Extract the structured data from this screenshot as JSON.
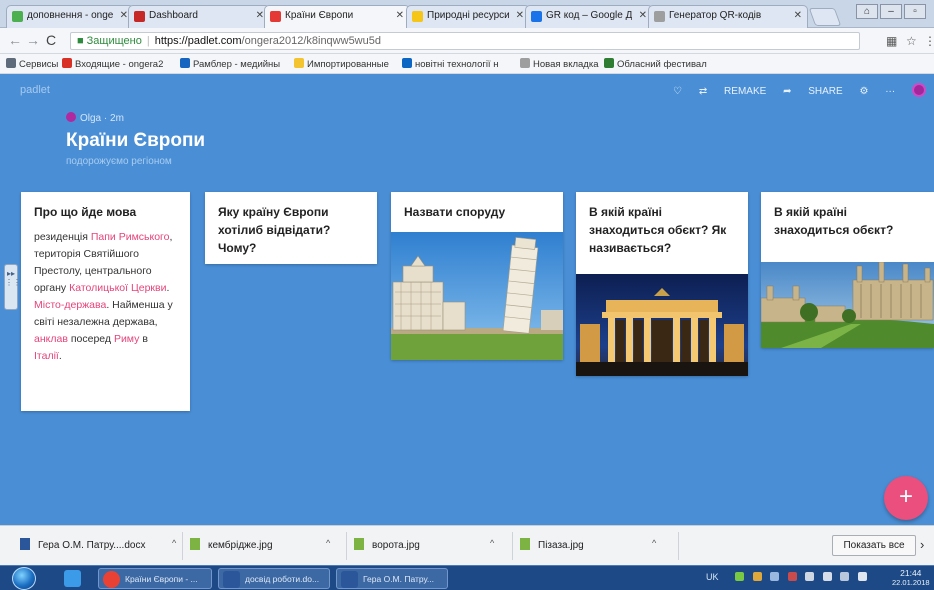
{
  "tabs": [
    {
      "label": "доповнення - ongera",
      "icon_color": "#4caf50"
    },
    {
      "label": "Dashboard",
      "icon_color": "#c62828"
    },
    {
      "label": "Країни Європи",
      "icon_color": "#e53935",
      "active": true
    },
    {
      "label": "Природні ресурси сві",
      "icon_color": "#f5c518"
    },
    {
      "label": "GR код – Google Диск",
      "icon_color": "#1a73e8"
    },
    {
      "label": "Генератор QR-кодів",
      "icon_color": "#9e9e9e"
    }
  ],
  "address": {
    "secure_label": "Защищено",
    "host": "https://padlet.com",
    "path": "/ongera2012/k8inqww5wu5d"
  },
  "bookmarks": [
    {
      "label": "Сервисы",
      "icon_color": "#5f6b7a"
    },
    {
      "label": "Входящие - ongera2",
      "icon_color": "#d93025"
    },
    {
      "label": "Рамблер - медийны",
      "icon_color": "#1565c0"
    },
    {
      "label": "Импортированные",
      "icon_color": "#f4c430"
    },
    {
      "label": "новітні технології н",
      "icon_color": "#0a66c2"
    },
    {
      "label": "Новая вкладка",
      "icon_color": "#9e9e9e"
    },
    {
      "label": "Обласний фестивал",
      "icon_color": "#2e7d32"
    }
  ],
  "padlet": {
    "logo": "padlet",
    "toolbar": {
      "remake": "REMAKE",
      "share": "SHARE"
    },
    "author": "Olga",
    "time": "2m",
    "title": "Країни Європи",
    "subtitle": "подорожуємо регіоном",
    "cards": [
      {
        "title": "Про що йде мова",
        "body": [
          {
            "t": "резиденція "
          },
          {
            "t": "Папи Римського",
            "hl": true
          },
          {
            "t": ", територія Святійшого Престолу, центрального органу "
          },
          {
            "t": "Католицької Церкви",
            "hl": true
          },
          {
            "t": ". "
          },
          {
            "t": "Місто-держава",
            "hl": true
          },
          {
            "t": ". Найменша у світі незалежна держава, "
          },
          {
            "t": "анклав",
            "hl": true
          },
          {
            "t": " посеред "
          },
          {
            "t": "Риму",
            "hl": true
          },
          {
            "t": " в "
          },
          {
            "t": "Італії",
            "hl": true
          },
          {
            "t": "."
          }
        ]
      },
      {
        "title": "Яку країну Європи хотілиб відвідати? Чому?"
      },
      {
        "title": "Назвати споруду",
        "image": "pisa-tower"
      },
      {
        "title": "В якій країні знаходиться обєкт? Як називається?",
        "image": "brandenburg-gate"
      },
      {
        "title": "В якій країні знаходиться обєкт?",
        "image": "cambridge-college"
      }
    ]
  },
  "downloads": [
    {
      "label": "Гера О.М. Патру....docx",
      "icon_color": "#2b579a"
    },
    {
      "label": "кембрідже.jpg",
      "icon_color": "#7cb342"
    },
    {
      "label": "ворота.jpg",
      "icon_color": "#7cb342"
    },
    {
      "label": "Пізаза.jpg",
      "icon_color": "#7cb342"
    }
  ],
  "downloads_show_all": "Показать все",
  "taskbar": {
    "apps": [
      {
        "label": "",
        "icon": "ie-icon",
        "icon_color": "#3b9be8"
      },
      {
        "label": "Країни Європи - ...",
        "icon": "chrome-icon",
        "icon_color": "#e94235"
      },
      {
        "label": "досвід роботи.do...",
        "icon": "word-icon",
        "icon_color": "#2b579a"
      },
      {
        "label": "Гера О.М. Патру...",
        "icon": "word-icon",
        "icon_color": "#2b579a"
      }
    ],
    "lang": "UK",
    "time": "21:44",
    "date": "22.01.2018"
  }
}
